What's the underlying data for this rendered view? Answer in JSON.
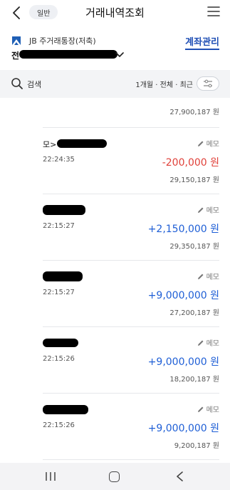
{
  "header": {
    "mode_badge": "일반",
    "title": "거래내역조회"
  },
  "account": {
    "name": "JB 주거래통장(저축)",
    "number_prefix": "전",
    "manage_label": "계좌관리"
  },
  "search": {
    "label": "검색",
    "filter_summary": "1개월 · 전체 · 최근"
  },
  "transactions": [
    {
      "description": "",
      "time": "",
      "amount": "",
      "balance": "27,900,187 원",
      "sign": "neg"
    },
    {
      "description": "모>",
      "time": "22:24:35",
      "amount": "-200,000 원",
      "balance": "29,150,187 원",
      "sign": "neg",
      "memo": "메모"
    },
    {
      "description": "",
      "time": "22:15:27",
      "amount": "+2,150,000 원",
      "balance": "29,350,187 원",
      "sign": "pos",
      "memo": "메모"
    },
    {
      "description": "",
      "time": "22:15:27",
      "amount": "+9,000,000 원",
      "balance": "27,200,187 원",
      "sign": "pos",
      "memo": "메모"
    },
    {
      "description": "",
      "time": "22:15:26",
      "amount": "+9,000,000 원",
      "balance": "18,200,187 원",
      "sign": "pos",
      "memo": "메모"
    },
    {
      "description": "",
      "time": "22:15:26",
      "amount": "+9,000,000 원",
      "balance": "9,200,187 원",
      "sign": "pos",
      "memo": "메모"
    }
  ],
  "colors": {
    "accent": "#1f4fb5",
    "negative": "#e0413a",
    "positive": "#1f5fd6"
  },
  "icons": [
    "back-icon",
    "menu-icon",
    "bank-logo-icon",
    "chevron-down-icon",
    "search-icon",
    "filter-icon",
    "pencil-icon",
    "recents-icon",
    "home-icon",
    "nav-back-icon"
  ]
}
